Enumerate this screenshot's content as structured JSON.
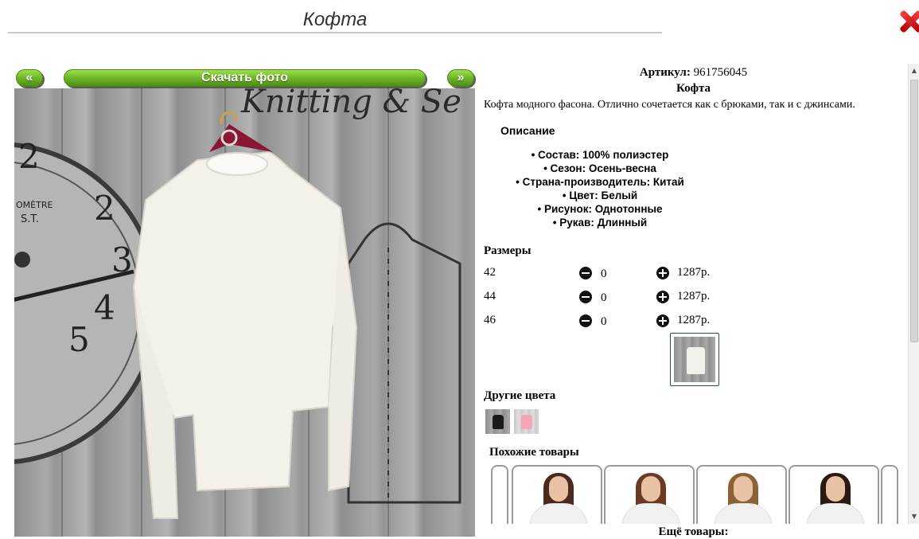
{
  "page": {
    "title": "Кофта"
  },
  "gallery": {
    "prev_label": "«",
    "download_label": "Скачать фото",
    "next_label": "»",
    "photo_text": {
      "sign": "Knitting & Se",
      "clock_numbers": [
        "2",
        "2",
        "3",
        "4",
        "5"
      ],
      "clock_brand": "OMÈTRE",
      "clock_brand2": "S.T."
    }
  },
  "product": {
    "article_label": "Артикул:",
    "article_value": "961756045",
    "name": "Кофта",
    "description": "Кофта модного фасона. Отлично сочетается как с брюками, так и с джинсами.",
    "description_heading": "Описание",
    "attributes": [
      "Состав: 100% полиэстер",
      "Сезон: Осень-весна",
      "Страна-производитель: Китай",
      "Цвет: Белый",
      "Рисунок: Однотонные",
      "Рукав: Длинный"
    ]
  },
  "sizes": {
    "heading": "Размеры",
    "rows": [
      {
        "size": "42",
        "qty": "0",
        "price": "1287р."
      },
      {
        "size": "44",
        "qty": "0",
        "price": "1287р."
      },
      {
        "size": "46",
        "qty": "0",
        "price": "1287р."
      }
    ]
  },
  "colors": {
    "heading": "Другие цвета",
    "swatches": [
      "black",
      "pink"
    ]
  },
  "similar": {
    "heading": "Похожие товары",
    "more_label": "Ещё товары:"
  },
  "icons": {
    "close": "close-icon",
    "minus": "minus-circle-icon",
    "plus": "plus-circle-icon"
  },
  "colors_theme": {
    "accent_green": "#6fb52a",
    "close_red": "#d00000"
  }
}
